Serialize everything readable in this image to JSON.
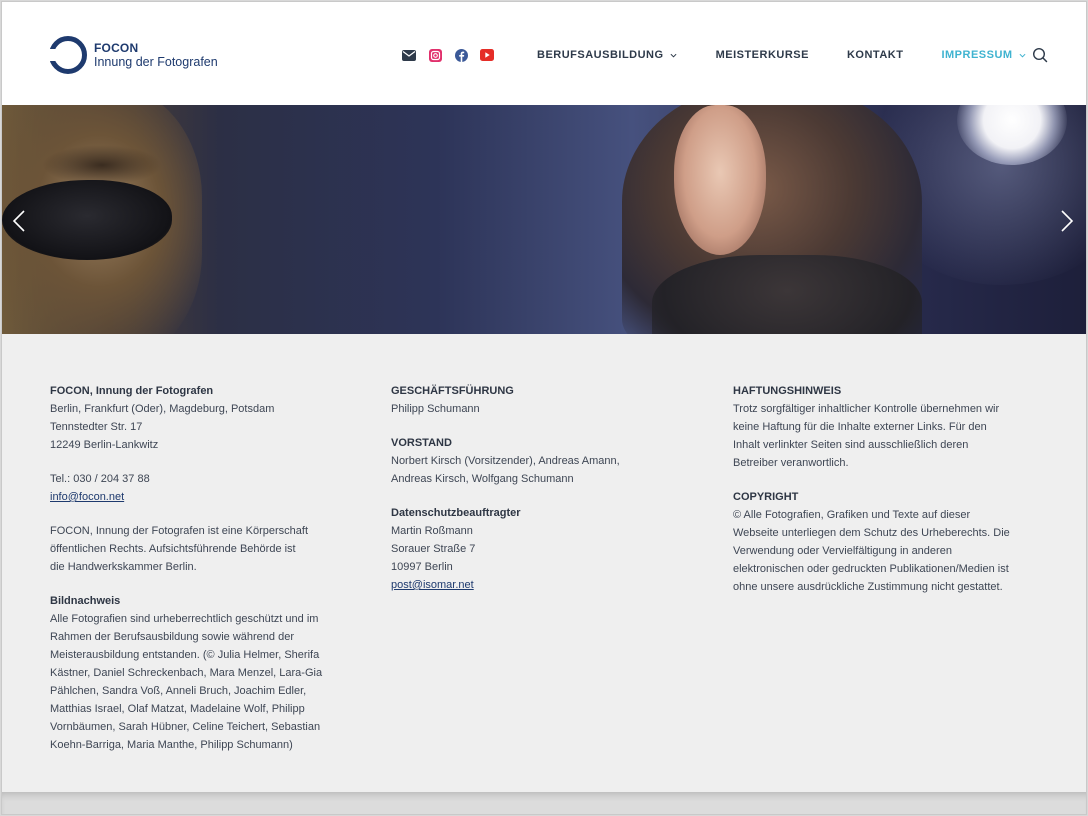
{
  "logo": {
    "name": "FOCON",
    "subtitle": "Innung der Fotografen"
  },
  "social": [
    {
      "icon": "mail-icon",
      "color": "#2e3a4a"
    },
    {
      "icon": "instagram-icon",
      "color": "#e1306c"
    },
    {
      "icon": "facebook-icon",
      "color": "#3b5998"
    },
    {
      "icon": "youtube-icon",
      "color": "#e52d27"
    }
  ],
  "nav": {
    "items": [
      {
        "label": "BERUFSAUSBILDUNG",
        "dropdown": true,
        "active": false
      },
      {
        "label": "MEISTERKURSE",
        "dropdown": false,
        "active": false
      },
      {
        "label": "KONTAKT",
        "dropdown": false,
        "active": false
      },
      {
        "label": "IMPRESSUM",
        "dropdown": true,
        "active": true
      }
    ],
    "accent_color": "#3fb3d0"
  },
  "col1": {
    "org_title": "FOCON, Innung der Fotografen",
    "cities": "Berlin, Frankfurt (Oder), Magdeburg, Potsdam",
    "street": "Tennstedter Str. 17",
    "zip_city": "12249 Berlin-Lankwitz",
    "phone": "Tel.: 030 / 204 37 88",
    "email": "info@focon.net",
    "body_lines": [
      "FOCON, Innung der Fotografen ist eine Körperschaft",
      "öffentlichen Rechts. Aufsichtsführende Behörde ist",
      "die Handwerkskammer Berlin."
    ],
    "credits_title": "Bildnachweis",
    "credits_lines": [
      "Alle Fotografien sind urheberrechtlich geschützt und im",
      "Rahmen der Berufsausbildung sowie während der",
      "Meisterausbildung entstanden. (© Julia Helmer, Sherifa",
      "Kästner, Daniel Schreckenbach, Mara Menzel, Lara-Gia",
      "Pählchen, Sandra Voß, Anneli Bruch, Joachim Edler,",
      "Matthias Israel, Olaf Matzat, Madelaine Wolf, Philipp",
      "Vornbäumen, Sarah Hübner, Celine Teichert, Sebastian",
      "Koehn-Barriga, Maria Manthe, Philipp Schumann)"
    ]
  },
  "col2": {
    "management_title": "GESCHÄFTSFÜHRUNG",
    "management_name": "Philipp Schumann",
    "board_title": "VORSTAND",
    "board_lines": [
      "Norbert Kirsch (Vorsitzender), Andreas Amann,",
      "Andreas Kirsch, Wolfgang Schumann"
    ],
    "privacy_title": "Datenschutzbeauftragter",
    "privacy_name": "Martin Roßmann",
    "privacy_street": "Sorauer Straße 7",
    "privacy_city": "10997 Berlin",
    "privacy_email": "post@isomar.net"
  },
  "col3": {
    "liability_title": "HAFTUNGSHINWEIS",
    "liability_lines": [
      "Trotz sorgfältiger inhaltlicher Kontrolle übernehmen wir",
      "keine Haftung für die Inhalte externer Links. Für den",
      "Inhalt verlinkter Seiten sind ausschließlich deren",
      "Betreiber veranwortlich."
    ],
    "copyright_title": "COPYRIGHT",
    "copyright_lines": [
      "© Alle Fotografien, Grafiken und Texte auf dieser",
      "Webseite unterliegen dem Schutz des Urheberechts. Die",
      "Verwendung oder Vervielfältigung in anderen",
      "elektronischen oder gedruckten Publikationen/Medien ist",
      "ohne unsere ausdrückliche Zustimmung nicht gestattet."
    ]
  },
  "colors": {
    "brand": "#1e3a6e",
    "text": "#3e4654",
    "footer_bg": "#efefef"
  }
}
